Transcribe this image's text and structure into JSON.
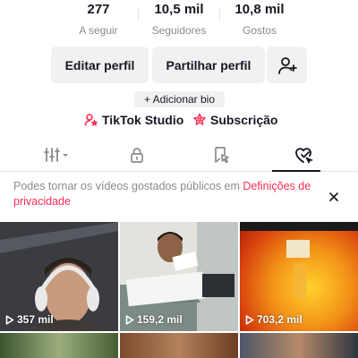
{
  "stats": [
    {
      "value": "277",
      "label": "A seguir"
    },
    {
      "value": "10,5 mil",
      "label": "Seguidores"
    },
    {
      "value": "10,8 mil",
      "label": "Gostos"
    }
  ],
  "actions": {
    "edit_profile": "Editar perfil",
    "share_profile": "Partilhar perfil",
    "add_bio": "+ Adicionar bio"
  },
  "links": {
    "studio": "TikTok Studio",
    "subscription": "Subscrição"
  },
  "tabs": [
    {
      "icon": "grid-icon"
    },
    {
      "icon": "lock-icon"
    },
    {
      "icon": "saved-icon"
    },
    {
      "icon": "liked-icon",
      "active": true
    }
  ],
  "notice": {
    "text": "Podes tornar os vídeos gostados públicos em ",
    "link": "Definições de privacidade"
  },
  "videos": [
    {
      "views": "357 mil"
    },
    {
      "views": "159,2 mil"
    },
    {
      "views": "703,2 mil"
    },
    {
      "views": ""
    },
    {
      "views": ""
    },
    {
      "views": ""
    }
  ],
  "colors": {
    "accent": "#fe2c55",
    "text": "#161823",
    "muted": "#8a8b91",
    "button_bg": "#f1f1f2"
  }
}
